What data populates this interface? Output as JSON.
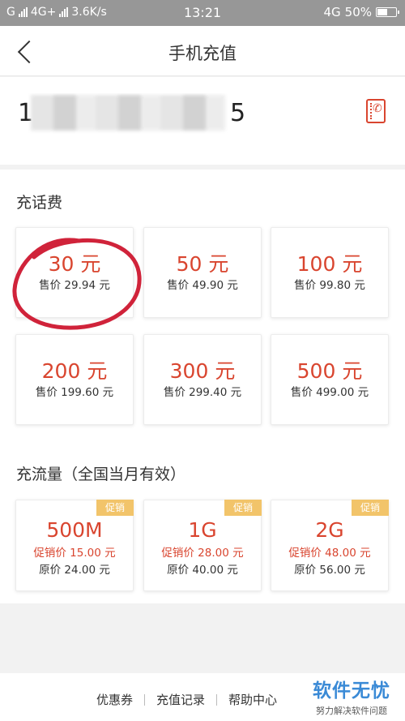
{
  "status_bar": {
    "carrier1": "G",
    "carrier2": "4G+",
    "net_speed": "3.6K/s",
    "time": "13:21",
    "net_type": "4G",
    "battery": "50%"
  },
  "header": {
    "title": "手机充值"
  },
  "phone": {
    "first_digit": "1",
    "last_digit": "5"
  },
  "talk_section": {
    "title": "充话费",
    "cards": [
      {
        "amount": "30 元",
        "price": "售价 29.94 元"
      },
      {
        "amount": "50 元",
        "price": "售价 49.90 元"
      },
      {
        "amount": "100 元",
        "price": "售价 99.80 元"
      },
      {
        "amount": "200 元",
        "price": "售价 199.60 元"
      },
      {
        "amount": "300 元",
        "price": "售价 299.40 元"
      },
      {
        "amount": "500 元",
        "price": "售价 499.00 元"
      }
    ]
  },
  "data_section": {
    "title": "充流量（全国当月有效）",
    "cards": [
      {
        "badge": "促销",
        "amount": "500M",
        "promo_price": "促销价 15.00 元",
        "orig_price": "原价 24.00 元"
      },
      {
        "badge": "促销",
        "amount": "1G",
        "promo_price": "促销价 28.00 元",
        "orig_price": "原价 40.00 元"
      },
      {
        "badge": "促销",
        "amount": "2G",
        "promo_price": "促销价 48.00 元",
        "orig_price": "原价 56.00 元"
      }
    ]
  },
  "bottom_bar": {
    "coupons": "优惠券",
    "records": "充值记录",
    "help": "帮助中心"
  },
  "watermark": {
    "line1": "软件无忧",
    "line2": "努力解决软件问题"
  },
  "colors": {
    "accent": "#d9452f",
    "badge": "#f2c46a",
    "annotation": "#d0233a"
  }
}
